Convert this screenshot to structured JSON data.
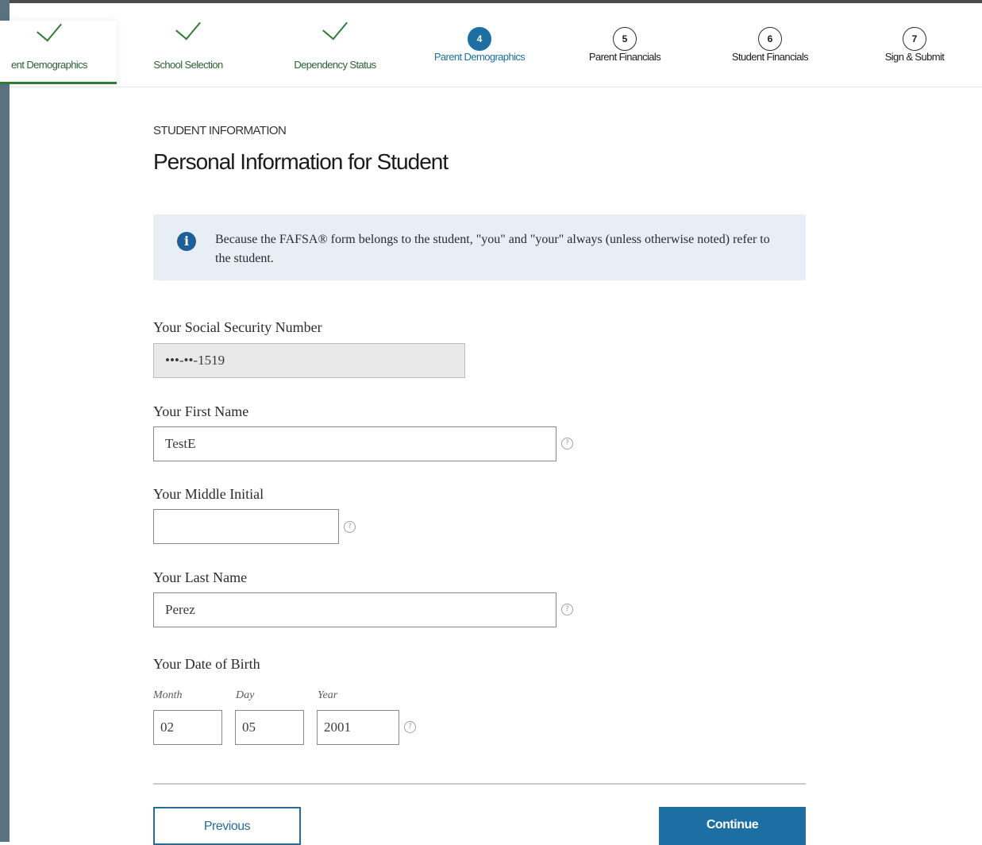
{
  "stepper": {
    "steps": [
      {
        "label": "ent Demographics",
        "status": "done"
      },
      {
        "label": "School Selection",
        "status": "done"
      },
      {
        "label": "Dependency Status",
        "status": "done"
      },
      {
        "label": "Parent Demographics",
        "status": "current",
        "number": "4"
      },
      {
        "label": "Parent Financials",
        "status": "upcoming",
        "number": "5"
      },
      {
        "label": "Student Financials",
        "status": "upcoming",
        "number": "6"
      },
      {
        "label": "Sign & Submit",
        "status": "upcoming",
        "number": "7"
      }
    ]
  },
  "section": {
    "kicker": "STUDENT INFORMATION",
    "title": "Personal Information for Student"
  },
  "info": {
    "icon": "info-icon",
    "text": "Because the FAFSA® form belongs to the student, \"you\" and \"your\" always (unless otherwise noted) refer to the student."
  },
  "fields": {
    "ssn": {
      "label": "Your Social Security Number",
      "value": "•••-••-1519"
    },
    "first_name": {
      "label": "Your First Name",
      "value": "TestE"
    },
    "middle_initial": {
      "label": "Your Middle Initial",
      "value": ""
    },
    "last_name": {
      "label": "Your Last Name",
      "value": "Perez"
    },
    "dob": {
      "label": "Your Date of Birth",
      "month_label": "Month",
      "month_value": "02",
      "day_label": "Day",
      "day_value": "05",
      "year_label": "Year",
      "year_value": "2001"
    }
  },
  "help_glyph": "?",
  "buttons": {
    "previous": "Previous",
    "continue": "Continue"
  },
  "colors": {
    "primary": "#1d6ea3",
    "done": "#2e7d32",
    "info_bg": "#e7eef6"
  }
}
